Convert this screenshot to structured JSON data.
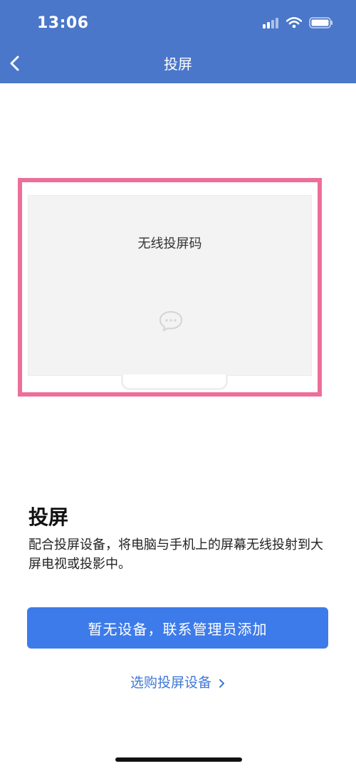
{
  "status_bar": {
    "time": "13:06"
  },
  "nav": {
    "title": "投屏",
    "back_icon": "chevron-left-icon"
  },
  "preview": {
    "screen_title": "无线投屏码",
    "icon": "chat-bubble-icon"
  },
  "content": {
    "title": "投屏",
    "description": "配合投屏设备，将电脑与手机上的屏幕无线投射到大屏电视或投影中。"
  },
  "actions": {
    "primary_label": "暂无设备，联系管理员添加",
    "link_label": "选购投屏设备"
  },
  "colors": {
    "header": "#4a77c9",
    "highlight_border": "#ed6f98",
    "primary_button": "#3e7bea",
    "link": "#3f78d6"
  }
}
